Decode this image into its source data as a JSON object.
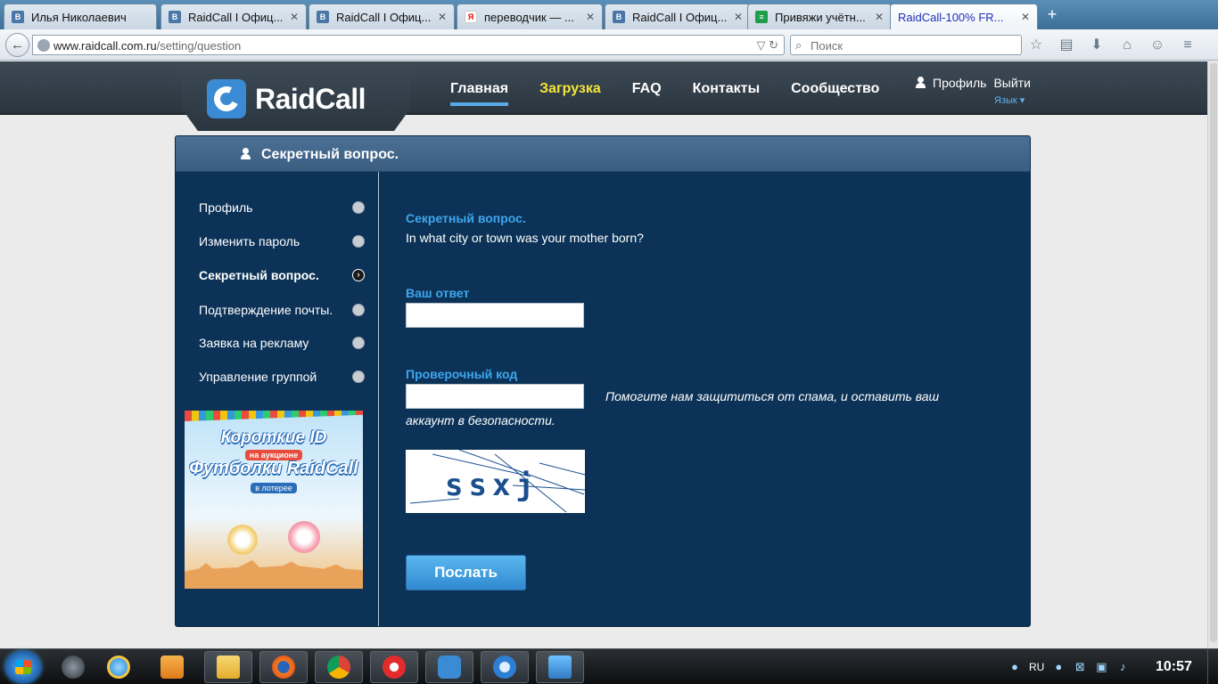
{
  "browser": {
    "tabs": [
      {
        "title": "Илья Николаевич",
        "icon": "vk-icon",
        "color": "#4a76a8",
        "glyph": "В"
      },
      {
        "title": "RaidCall I Офиц...",
        "icon": "vk-icon",
        "color": "#4a76a8",
        "glyph": "В"
      },
      {
        "title": "RaidCall I Офиц...",
        "icon": "vk-icon",
        "color": "#4a76a8",
        "glyph": "В"
      },
      {
        "title": "переводчик — ...",
        "icon": "yandex-icon",
        "color": "#ffffff",
        "glyph": "Я"
      },
      {
        "title": "RaidCall I Офиц...",
        "icon": "vk-icon",
        "color": "#4a76a8",
        "glyph": "В"
      },
      {
        "title": "Привяжи учётн...",
        "icon": "sheets-icon",
        "color": "#1e9e4a",
        "glyph": "≡"
      },
      {
        "title": "RaidCall-100% FR...",
        "icon": "none",
        "color": "",
        "glyph": ""
      }
    ],
    "new_tab_label": "+",
    "url_host": "www.raidcall.com.ru",
    "url_path": "/setting/question",
    "search_placeholder": "Поиск"
  },
  "site": {
    "logo_text": "RaidCall",
    "nav": [
      {
        "label": "Главная",
        "active": true
      },
      {
        "label": "Загрузка",
        "highlight": true
      },
      {
        "label": "FAQ"
      },
      {
        "label": "Контакты"
      },
      {
        "label": "Сообщество"
      }
    ],
    "profile_label": "Профиль",
    "logout_label": "Выйти",
    "language_label": "Язык ▾"
  },
  "panel": {
    "title": "Секретный вопрос.",
    "sidebar": [
      {
        "label": "Профиль"
      },
      {
        "label": "Изменить пароль"
      },
      {
        "label": "Секретный вопрос.",
        "active": true
      },
      {
        "label": "Подтверждение почты."
      },
      {
        "label": "Заявка на рекламу"
      },
      {
        "label": "Управление группой"
      }
    ],
    "banner": {
      "line1": "Короткие ID",
      "line2": "на аукционе",
      "line3": "Футболки RaidCall",
      "line4": "в лотерее"
    },
    "question_label": "Секретный вопрос.",
    "question_text": "In what city or town was your mother born?",
    "answer_label": "Ваш ответ",
    "answer_value": "",
    "captcha_label": "Проверочный код",
    "captcha_value": "",
    "captcha_hint": "Помогите нам защититься от спама, и оставить ваш аккаунт в безопасности.",
    "captcha_image_text": "ssxj",
    "submit_label": "Послать"
  },
  "taskbar": {
    "lang": "RU",
    "clock": "10:57"
  }
}
